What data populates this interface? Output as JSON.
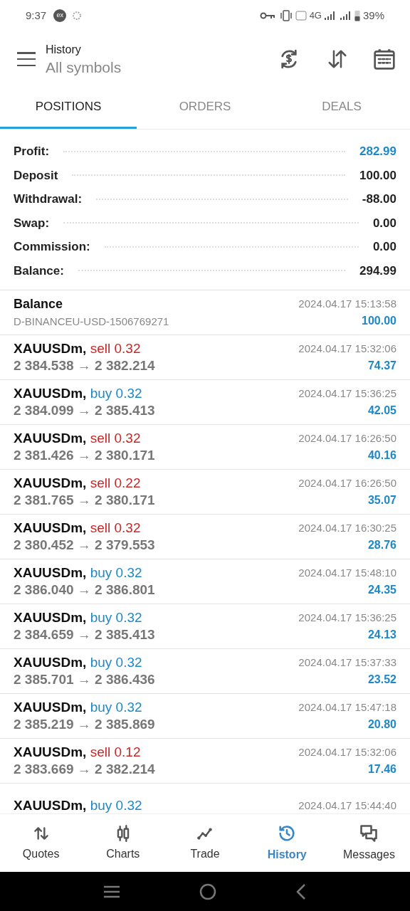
{
  "status_bar": {
    "time": "9:37",
    "app_badge": "ex",
    "network": "4G",
    "battery": "39%"
  },
  "header": {
    "title": "History",
    "subtitle": "All symbols"
  },
  "tabs": [
    {
      "label": "POSITIONS",
      "selected": true
    },
    {
      "label": "ORDERS",
      "selected": false
    },
    {
      "label": "DEALS",
      "selected": false
    }
  ],
  "summary": [
    {
      "label": "Profit:",
      "value": "282.99",
      "highlight": true
    },
    {
      "label": "Deposit",
      "value": "100.00",
      "highlight": false
    },
    {
      "label": "Withdrawal:",
      "value": "-88.00",
      "highlight": false
    },
    {
      "label": "Swap:",
      "value": "0.00",
      "highlight": false
    },
    {
      "label": "Commission:",
      "value": "0.00",
      "highlight": false
    },
    {
      "label": "Balance:",
      "value": "294.99",
      "highlight": false
    }
  ],
  "rows": [
    {
      "kind": "balance",
      "title": "Balance",
      "detail": "D-BINANCEU-USD-1506769271",
      "time": "2024.04.17 15:13:58",
      "amount": "100.00"
    },
    {
      "kind": "trade",
      "symbol": "XAUUSDm,",
      "side": "sell",
      "color": "#c62828",
      "volume": "0.32",
      "prices": "2 384.538 → 2 382.214",
      "time": "2024.04.17 15:32:06",
      "amount": "74.37"
    },
    {
      "kind": "trade",
      "symbol": "XAUUSDm,",
      "side": "buy",
      "color": "#1e88c8",
      "volume": "0.32",
      "prices": "2 384.099 → 2 385.413",
      "time": "2024.04.17 15:36:25",
      "amount": "42.05"
    },
    {
      "kind": "trade",
      "symbol": "XAUUSDm,",
      "side": "sell",
      "color": "#c62828",
      "volume": "0.32",
      "prices": "2 381.426 → 2 380.171",
      "time": "2024.04.17 16:26:50",
      "amount": "40.16"
    },
    {
      "kind": "trade",
      "symbol": "XAUUSDm,",
      "side": "sell",
      "color": "#c62828",
      "volume": "0.22",
      "prices": "2 381.765 → 2 380.171",
      "time": "2024.04.17 16:26:50",
      "amount": "35.07"
    },
    {
      "kind": "trade",
      "symbol": "XAUUSDm,",
      "side": "sell",
      "color": "#c62828",
      "volume": "0.32",
      "prices": "2 380.452 → 2 379.553",
      "time": "2024.04.17 16:30:25",
      "amount": "28.76"
    },
    {
      "kind": "trade",
      "symbol": "XAUUSDm,",
      "side": "buy",
      "color": "#1e88c8",
      "volume": "0.32",
      "prices": "2 386.040 → 2 386.801",
      "time": "2024.04.17 15:48:10",
      "amount": "24.35"
    },
    {
      "kind": "trade",
      "symbol": "XAUUSDm,",
      "side": "buy",
      "color": "#1e88c8",
      "volume": "0.32",
      "prices": "2 384.659 → 2 385.413",
      "time": "2024.04.17 15:36:25",
      "amount": "24.13"
    },
    {
      "kind": "trade",
      "symbol": "XAUUSDm,",
      "side": "buy",
      "color": "#1e88c8",
      "volume": "0.32",
      "prices": "2 385.701 → 2 386.436",
      "time": "2024.04.17 15:37:33",
      "amount": "23.52"
    },
    {
      "kind": "trade",
      "symbol": "XAUUSDm,",
      "side": "buy",
      "color": "#1e88c8",
      "volume": "0.32",
      "prices": "2 385.219 → 2 385.869",
      "time": "2024.04.17 15:47:18",
      "amount": "20.80"
    },
    {
      "kind": "trade",
      "symbol": "XAUUSDm,",
      "side": "sell",
      "color": "#c62828",
      "volume": "0.12",
      "prices": "2 383.669 → 2 382.214",
      "time": "2024.04.17 15:32:06",
      "amount": "17.46"
    },
    {
      "kind": "trade",
      "symbol": "XAUUSDm,",
      "side": "buy",
      "color": "#1e88c8",
      "volume": "0.32",
      "time": "2024.04.17 15:44:40"
    }
  ],
  "bottom_nav": [
    {
      "label": "Quotes",
      "selected": false
    },
    {
      "label": "Charts",
      "selected": false
    },
    {
      "label": "Trade",
      "selected": false
    },
    {
      "label": "History",
      "selected": true
    },
    {
      "label": "Messages",
      "selected": false
    }
  ]
}
